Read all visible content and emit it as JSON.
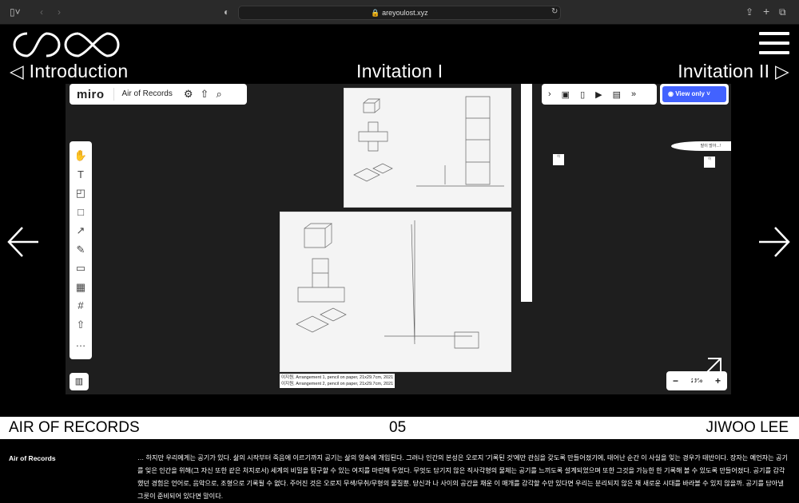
{
  "browser": {
    "url": "areyoulost.xyz"
  },
  "nav": {
    "prev": "◁ Introduction",
    "current": "Invitation I",
    "next": "Invitation II ▷"
  },
  "miro": {
    "brand": "miro",
    "board_title": "Air of Records",
    "view_label": "View only",
    "zoom_level": "21%",
    "captions": [
      "이지원, Arrangement 1, pencil on paper, 21x29.7cm, 2021",
      "이지원, Arrangement 2, pencil on paper, 21x29.7cm, 2021"
    ],
    "bubble": "말이 많아...!",
    "note_text": "히",
    "accent": "#4262ff"
  },
  "footer": {
    "title": "AIR OF RECORDS",
    "number": "05",
    "author": "JIWOO LEE"
  },
  "description": {
    "label": "Air of Records",
    "text": "… 하지만 우리에게는 공기가 있다. 삶의 시작부터 죽음에 이르기까지 공기는 삶의 영속에 개입된다. 그러나 인간의 본성은 오로지 '기록된 것'에만 관심을 갖도록 만들어졌기에, 태어난 순간 이 사실을 잊는 경우가 태반이다. 장자는 예언자는 공기를 잊은 인간을 위해(그 자신 또한 같은 처지로서) 세계의 비밀을 탐구할 수 있는 여지를 마련해 두었다. 무엇도 담기지 않은 직사각형의 물체는 공기를 느끼도록 설계되었으며 또한 그것을 가능한 한 기록해 볼 수 있도록 만들어졌다. 공기를 감각했던 경험은 언어로, 음악으로, 조형으로 기록될 수 없다. 주어진 것은 오로지 무색/무취/무형의 물질뿐. 당신과 나 사이의 공간을 채운 이 매개를 감각할 수만 있다면 우리는 분리되지 않은 채 새로운 시대를 바라볼 수 있지 않을까. 공기를 담아낼 그릇이 준비되어 있다면 말이다."
  }
}
